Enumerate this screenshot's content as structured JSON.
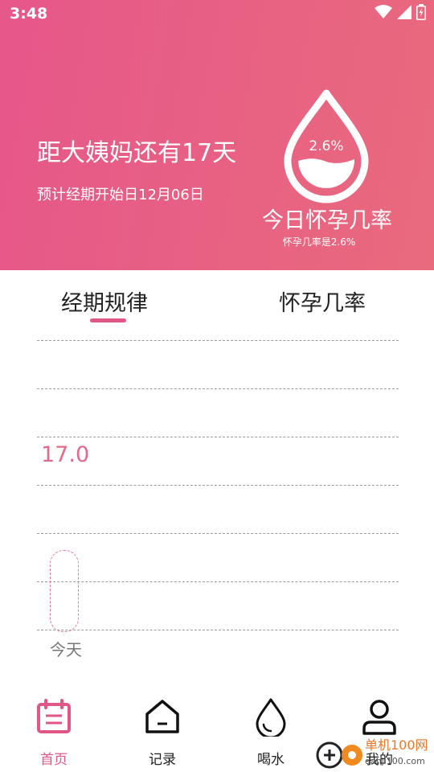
{
  "status_bar": {
    "time": "3:48",
    "icons": [
      "wifi-icon",
      "signal-icon",
      "battery-icon"
    ]
  },
  "header": {
    "countdown": "距大姨妈还有17天",
    "predicted_start": "预计经期开始日12月06日",
    "drop_percent": "2.6%",
    "pregnancy_title": "今日怀孕几率",
    "pregnancy_sub": "怀孕几率是2.6%"
  },
  "tabs": [
    {
      "label": "经期规律",
      "active": true
    },
    {
      "label": "怀孕几率",
      "active": false
    }
  ],
  "chart": {
    "axis_value": "17.0",
    "today_label": "今天"
  },
  "bottom_nav": [
    {
      "label": "首页",
      "icon": "calendar-icon",
      "active": true
    },
    {
      "label": "记录",
      "icon": "home-icon",
      "active": false
    },
    {
      "label": "喝水",
      "icon": "water-drop-icon",
      "active": false
    },
    {
      "label": "我的",
      "icon": "profile-icon",
      "active": false
    }
  ],
  "watermark": {
    "text": "单机100网",
    "url_text": "danji100.com"
  },
  "colors": {
    "accent": "#e05787",
    "header_gradient_start": "#e6578a",
    "header_gradient_end": "#e96a7d"
  }
}
